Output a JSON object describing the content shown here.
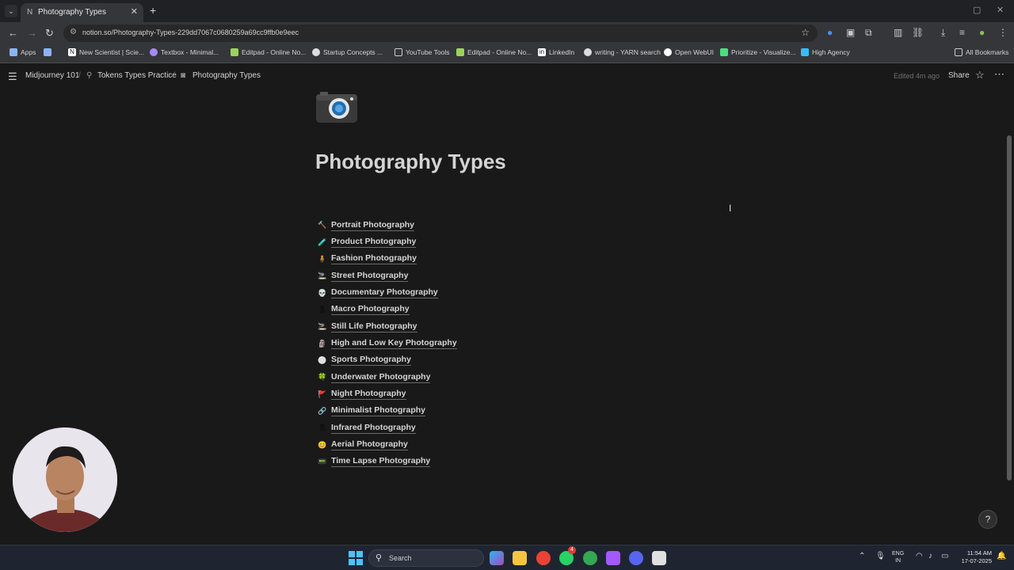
{
  "browser": {
    "tab": {
      "title": "Photography Types",
      "favicon": "notion-icon"
    },
    "url": "notion.so/Photography-Types-229dd7067c0680259a69cc9ffb0e9eec",
    "bookmarks": [
      {
        "label": "Apps",
        "icon": "apps-grid-icon",
        "color": "#8ab4f8"
      },
      {
        "label": "",
        "icon": "grid-icon",
        "color": "#8ab4f8"
      },
      {
        "label": "New Scientist | Scie...",
        "icon": "ns-icon",
        "color": "#ffffff"
      },
      {
        "label": "Textbox - Minimal...",
        "icon": "textbox-icon",
        "color": "#a78bfa"
      },
      {
        "label": "Editpad - Online No...",
        "icon": "editpad-icon",
        "color": "#9bd35a"
      },
      {
        "label": "Startup Concepts ...",
        "icon": "startup-icon",
        "color": "#dddddd"
      },
      {
        "label": "YouTube Tools",
        "icon": "folder-icon",
        "color": "#cccccc"
      },
      {
        "label": "Editpad - Online No...",
        "icon": "editpad-icon",
        "color": "#9bd35a"
      },
      {
        "label": "LinkedIn",
        "icon": "linkedin-icon",
        "color": "#ffffff"
      },
      {
        "label": "writing - YARN search",
        "icon": "yarn-icon",
        "color": "#dddddd"
      },
      {
        "label": "Open WebUI",
        "icon": "openwebui-icon",
        "color": "#ffffff"
      },
      {
        "label": "Prioritize - Visualize...",
        "icon": "prioritize-icon",
        "color": "#4ade80"
      },
      {
        "label": "High Agency",
        "icon": "highagency-icon",
        "color": "#38bdf8"
      },
      {
        "label": "All Bookmarks",
        "icon": "folder-icon",
        "color": "#cccccc"
      }
    ]
  },
  "notion": {
    "breadcrumbs": [
      "Midjourney 101",
      "Tokens Types Practice",
      "Photography Types"
    ],
    "edited": "Edited 4m ago",
    "share": "Share",
    "page_title": "Photography Types",
    "items": [
      {
        "label": "Portrait Photography",
        "emoji": "🔨"
      },
      {
        "label": "Product Photography",
        "emoji": "🧪"
      },
      {
        "label": "Fashion Photography",
        "emoji": "🧍"
      },
      {
        "label": "Street Photography",
        "emoji": "🚬"
      },
      {
        "label": "Documentary Photography",
        "emoji": "💀"
      },
      {
        "label": "Macro Photography",
        "emoji": "🎗"
      },
      {
        "label": "Still Life Photography",
        "emoji": "🚬"
      },
      {
        "label": "High and Low Key Photography",
        "emoji": "🗿"
      },
      {
        "label": "Sports Photography",
        "emoji": "⚪"
      },
      {
        "label": "Underwater Photography",
        "emoji": "🍀"
      },
      {
        "label": "Night Photography",
        "emoji": "🚩"
      },
      {
        "label": "Minimalist Photography",
        "emoji": "🔗"
      },
      {
        "label": "Infrared Photography",
        "emoji": "🎗"
      },
      {
        "label": "Aerial Photography",
        "emoji": "😊"
      },
      {
        "label": "Time Lapse Photography",
        "emoji": "📟"
      }
    ]
  },
  "taskbar": {
    "search_placeholder": "Search",
    "language": "ENG",
    "region": "IN",
    "time": "11:54 AM",
    "date": "17-07-2025",
    "whatsapp_badge": "4"
  }
}
